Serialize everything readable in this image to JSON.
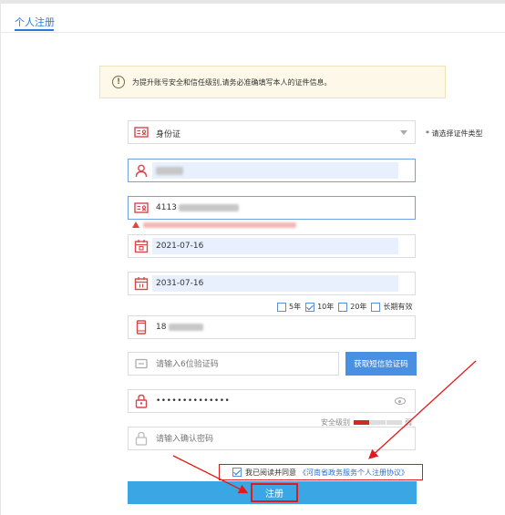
{
  "tab": {
    "label": "个人注册"
  },
  "notice": {
    "text": "为提升账号安全和信任级别,请务必准确填写本人的证件信息。"
  },
  "form": {
    "id_type": {
      "value": "身份证",
      "side_hint": "* 请选择证件类型"
    },
    "id_number": {
      "visible_prefix": "4113"
    },
    "start_date": {
      "value": "2021-07-16"
    },
    "end_date": {
      "value": "2031-07-16"
    },
    "validity_options": [
      {
        "label": "5年",
        "checked": false
      },
      {
        "label": "10年",
        "checked": true
      },
      {
        "label": "20年",
        "checked": false
      },
      {
        "label": "长期有效",
        "checked": false
      }
    ],
    "phone": {
      "visible_prefix": "18"
    },
    "sms_code": {
      "placeholder": "请输入6位验证码",
      "button_label": "获取短信验证码"
    },
    "password": {
      "value": "••••••••••••••"
    },
    "strength": {
      "label": "安全级别",
      "level_label": "弱"
    },
    "confirm_password": {
      "placeholder": "请输入确认密码"
    }
  },
  "agreement": {
    "text": "我已阅读并同意",
    "link": "《河南省政务服务个人注册协议》"
  },
  "submit": {
    "label": "注册"
  },
  "colors": {
    "accent": "#2a7ad9",
    "button": "#3aa7e4",
    "sms_button": "#4a90e2",
    "annotation": "#e01b1b",
    "icon": "#d8464a"
  }
}
